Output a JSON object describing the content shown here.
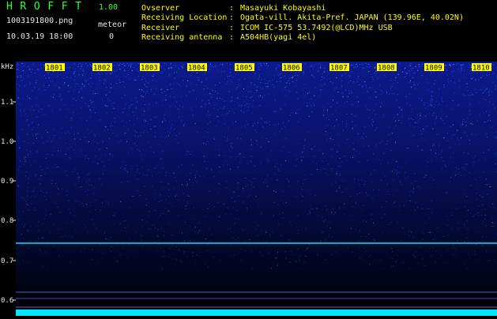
{
  "app": {
    "title": "HROFFT",
    "version": "1.00"
  },
  "file": {
    "name": "1003191800.png",
    "datetime": "10.03.19 18:00"
  },
  "meteor": {
    "label": "meteor",
    "count": "0"
  },
  "info": [
    {
      "label": "Ovserver",
      "value": "Masayuki Kobayashi"
    },
    {
      "label": "Receiving Location",
      "value": "Ogata-vill. Akita-Pref. JAPAN (139.96E, 40.02N)"
    },
    {
      "label": "Receiver",
      "value": "ICOM IC-575 53.7492(@LCD)MHz USB"
    },
    {
      "label": "Receiving antenna",
      "value": "A504HB(yagi 4el)"
    }
  ],
  "info_separator": ":",
  "plot": {
    "y_unit": "kHz",
    "y_ticks": [
      "1.1",
      "1.0",
      "0.9",
      "0.8",
      "0.7",
      "0.6"
    ],
    "time_marks": [
      "1801",
      "1802",
      "1803",
      "1804",
      "1805",
      "1806",
      "1807",
      "1808",
      "1809",
      "1810"
    ],
    "colors": {
      "background": "#000000",
      "noise": "#1e3cff",
      "trace": "#00e8ff",
      "label_bg": "#ffff00"
    }
  }
}
